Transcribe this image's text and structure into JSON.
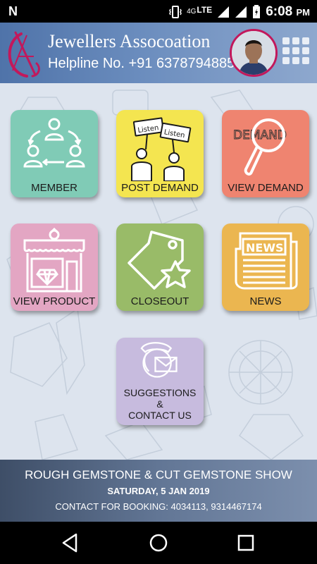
{
  "status_bar": {
    "carrier_icon": "N",
    "network_type": "4G",
    "lte": "LTE",
    "time": "6:08",
    "ampm": "PM"
  },
  "header": {
    "title": "Jewellers Assocoation",
    "helpline": "Helpline No. +91 6378794885",
    "logo_icon": "jewellers-logo-icon",
    "menu_icon": "grid-menu-icon"
  },
  "tiles": [
    {
      "label": "MEMBER",
      "color": "#80cbb6"
    },
    {
      "label": "POST DEMAND",
      "color": "#f4e550",
      "sign_text": "Listen"
    },
    {
      "label": "VIEW DEMAND",
      "color": "#ef8470",
      "sign_text": "DEMAND"
    },
    {
      "label": "VIEW PRODUCT",
      "color": "#e3a6c3"
    },
    {
      "label": "CLOSEOUT",
      "color": "#99bb68"
    },
    {
      "label": "NEWS",
      "color": "#ebb650",
      "sign_text": "NEWS"
    },
    {
      "label_line1": "SUGGESTIONS",
      "label_line2": "&",
      "label_line3": "CONTACT US",
      "color": "#c7bbde"
    }
  ],
  "banner": {
    "line1": "ROUGH GEMSTONE & CUT GEMSTONE SHOW",
    "line2": "SATURDAY, 5 JAN 2019",
    "line3": "CONTACT FOR BOOKING: 4034113, 9314467174"
  },
  "nav": {
    "back_icon": "back-icon",
    "home_icon": "home-icon",
    "recents_icon": "recents-icon"
  }
}
